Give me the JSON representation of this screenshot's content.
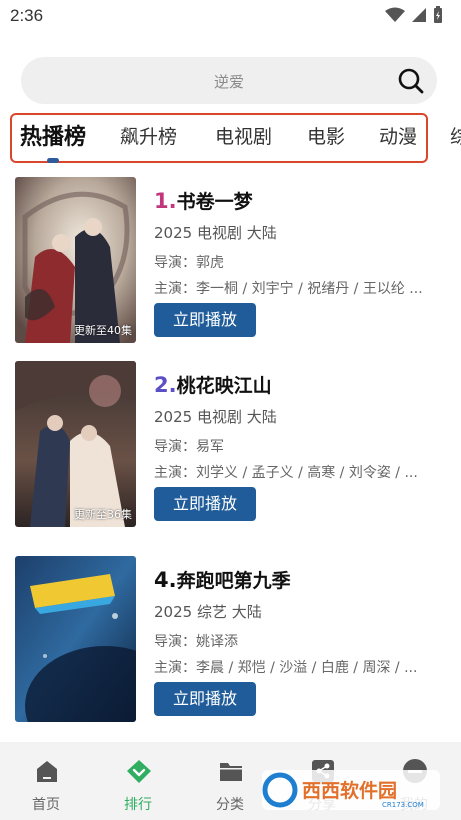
{
  "status_bar": {
    "time": "2:36"
  },
  "search": {
    "placeholder": "逆爱"
  },
  "tabs": [
    {
      "label": "热播榜"
    },
    {
      "label": "飙升榜"
    },
    {
      "label": "电视剧"
    },
    {
      "label": "电影"
    },
    {
      "label": "动漫"
    },
    {
      "label": "综"
    }
  ],
  "list": [
    {
      "rank": "1.",
      "title": "书卷一梦",
      "meta": "2025  电视剧  大陆",
      "director": "导演：郭虎",
      "cast": "主演：李一桐 / 刘宇宁 / 祝绪丹 / 王以纶 ...",
      "badge": "更新至40集",
      "play_label": "立即播放",
      "rank_color": "#c2367e"
    },
    {
      "rank": "2.",
      "title": "桃花映江山",
      "meta": "2025  电视剧  大陆",
      "director": "导演：易军",
      "cast": "主演：刘学义 / 孟子义 / 高寒 / 刘令姿 / ...",
      "badge": "更新至36集",
      "play_label": "立即播放",
      "rank_color": "#5a4fc6"
    },
    {
      "rank": "4.",
      "title": "奔跑吧第九季",
      "meta": "2025  综艺  大陆",
      "director": "导演：姚译添",
      "cast": "主演：李晨 / 郑恺 / 沙溢 / 白鹿 / 周深 / ...",
      "badge": "",
      "play_label": "立即播放",
      "rank_color": "#111111"
    }
  ],
  "bottom_nav": [
    {
      "label": "首页",
      "icon": "home-icon"
    },
    {
      "label": "排行",
      "icon": "rank-icon",
      "active": true
    },
    {
      "label": "分类",
      "icon": "folder-icon"
    },
    {
      "label": "分享",
      "icon": "share-icon"
    },
    {
      "label": "我的",
      "icon": "profile-icon"
    }
  ],
  "watermark": {
    "text": "西西软件园",
    "sub": "CR173.COM"
  },
  "colors": {
    "accent": "#2fae61",
    "button": "#1f5c99",
    "tab_border": "#d9472b"
  }
}
